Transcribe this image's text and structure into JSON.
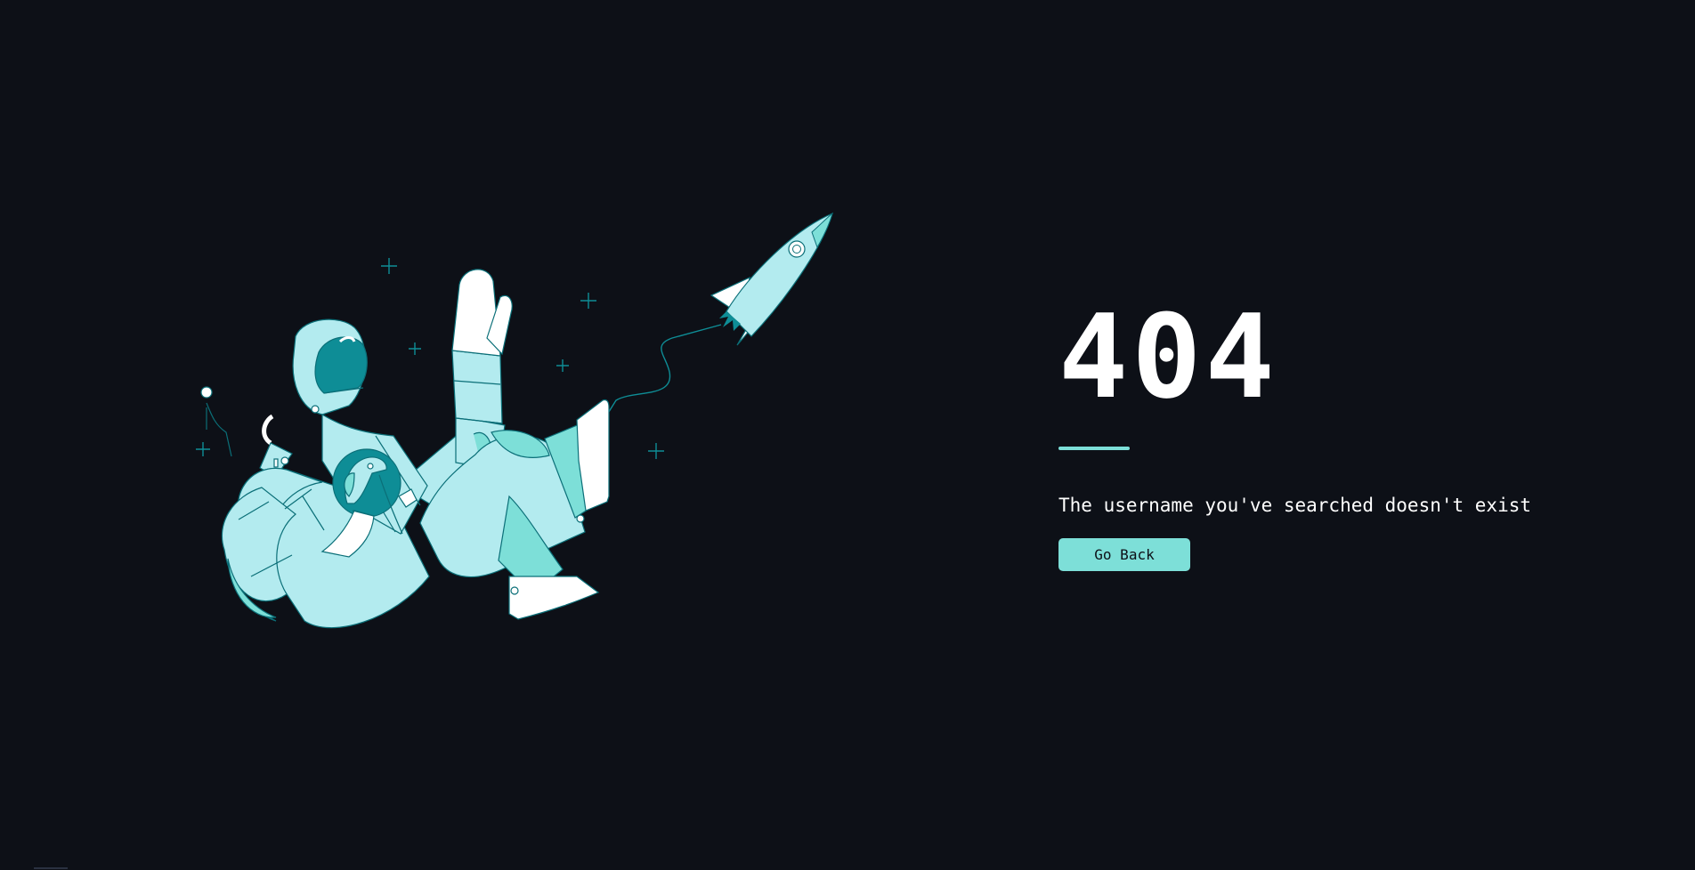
{
  "error": {
    "code": "404",
    "message": "The username you've searched doesn't exist"
  },
  "actions": {
    "back_label": "Go Back"
  },
  "illustration": {
    "subject": "astronaut-with-dog-and-rocket",
    "colors": {
      "background": "#0d1017",
      "suit_light": "#b3ebef",
      "suit_mid": "#7ddfd8",
      "visor": "#0e8d96",
      "outline": "#0b6f78",
      "white": "#ffffff"
    }
  },
  "theme": {
    "accent": "#7ddfd8",
    "text": "#ffffff"
  }
}
